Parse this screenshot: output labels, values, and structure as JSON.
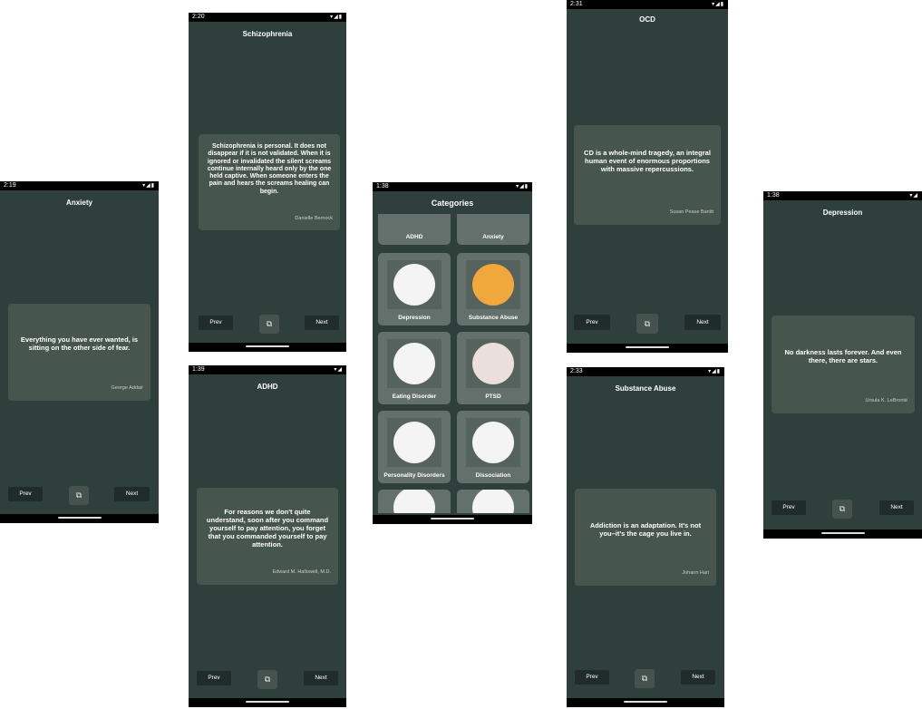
{
  "common": {
    "prev_label": "Prev",
    "next_label": "Next",
    "copy_icon": "copy-icon"
  },
  "anxiety": {
    "time": "2:19",
    "title": "Anxiety",
    "quote": "Everything you have ever wanted, is sitting on the other side of fear.",
    "author": "George Addair"
  },
  "schizophrenia": {
    "time": "2:20",
    "title": "Schizophrenia",
    "quote": "Schizophrenia is personal. It does not disappear if it is not validated. When it is ignored or invalidated the silent screams continue internally heard only by the one held captive. When someone enters the pain and hears the screams healing can begin.",
    "author": "Danielle Bernock"
  },
  "adhd": {
    "time": "1:39",
    "title": "ADHD",
    "quote": "For reasons we don't quite understand, soon after you command yourself to pay attention, you forget that you commanded yourself to pay attention.",
    "author": "Edward M. Hallowell, M.D."
  },
  "categories": {
    "time": "1:38",
    "title": "Categories",
    "items": [
      "ADHD",
      "Anxiety",
      "Depression",
      "Substance Abuse",
      "Eating Disorder",
      "PTSD",
      "Personality Disorders",
      "Dissociation"
    ]
  },
  "ocd": {
    "time": "2:31",
    "title": "OCD",
    "quote": "CD is a whole-mind tragedy, an integral human event of enormous proportions with massive repercussions.",
    "author": "Susan Pease Banitt"
  },
  "substance": {
    "time": "2:33",
    "title": "Substance Abuse",
    "quote": "Addiction is an adaptation. It's not you–it's the cage you live in.",
    "author": "Johann Hari"
  },
  "depression": {
    "time": "1:38",
    "title": "Depression",
    "quote": "No darkness lasts forever. And even there, there are stars.",
    "author": "Ursula K. LeBrontë"
  }
}
